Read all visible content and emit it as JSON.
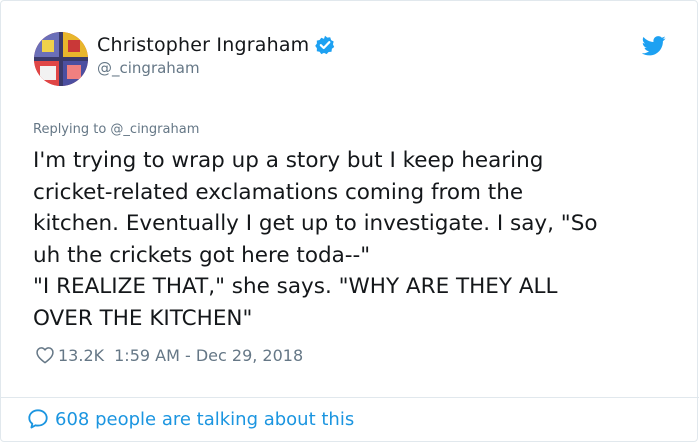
{
  "tweet": {
    "author": {
      "display_name": "Christopher Ingraham",
      "handle": "@_cingraham",
      "verified": true
    },
    "replying_to": "Replying to @_cingraham",
    "text_lines": [
      "I'm trying to wrap up a story but I keep hearing",
      "cricket-related exclamations coming from the",
      "kitchen. Eventually I get up to investigate. I say, \"So",
      "uh the crickets got here toda--\"",
      "\"I REALIZE THAT,\" she says. \"WHY ARE THEY ALL",
      "OVER THE KITCHEN\""
    ],
    "likes": "13.2K",
    "timestamp": "1:59 AM - Dec 29, 2018",
    "talking": "608 people are talking about this"
  },
  "colors": {
    "link": "#1b95e0",
    "muted": "#657786",
    "text": "#14171a",
    "verified": "#1da1f2"
  },
  "icons": {
    "verified": "verified-badge-icon",
    "logo": "twitter-bird-icon",
    "like": "heart-outline-icon",
    "talking": "speech-bubble-icon"
  }
}
